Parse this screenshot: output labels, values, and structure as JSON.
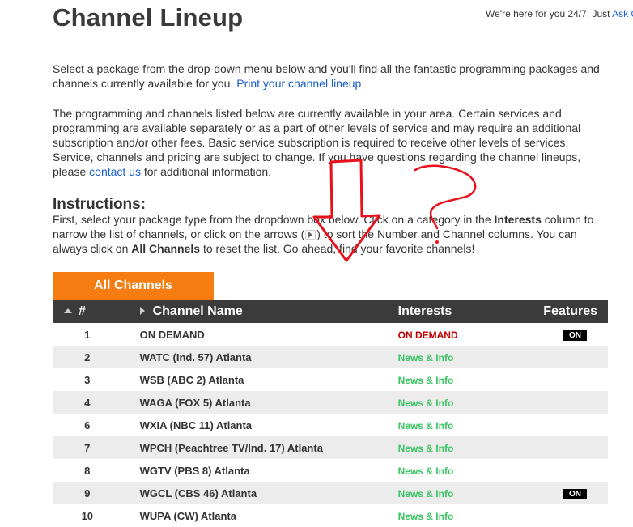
{
  "header": {
    "title": "Channel Lineup",
    "support_text": "We're here for you 24/7. Just",
    "support_link": "Ask Q"
  },
  "intro": {
    "text": "Select a package from the drop-down menu below and you'll find all the fantastic programming packages and channels currently available for you.",
    "print_link": "Print your channel lineup."
  },
  "disclaimer": {
    "text_before": "The programming and channels listed below are currently available in your area. Certain services and programming are available separately or as a part of other levels of service and may require an additional subscription and/or other fees. Basic service subscription is required to receive other levels of services. Service, channels and pricing are subject to change. If you have questions regarding the channel lineups, please",
    "contact_link": "contact us",
    "text_after": "for additional information."
  },
  "instructions": {
    "heading": "Instructions:",
    "part1": "First, select your package type from the dropdown box below. Click on a category in the",
    "interests_word": "Interests",
    "part2": "column to narrow the list of channels, or click on the arrows (",
    "part3": ") to sort the Number and Channel columns. You can always click on",
    "all_channels_word": "All Channels",
    "part4": "to reset the list. Go ahead, find your favorite channels!"
  },
  "tabs": {
    "all_channels": "All Channels"
  },
  "table": {
    "headers": {
      "number": "#",
      "name": "Channel Name",
      "interests": "Interests",
      "features": "Features"
    },
    "rows": [
      {
        "number": "1",
        "name": "ON DEMAND",
        "interest": "ON DEMAND",
        "interest_type": "ondemand",
        "feature": "ON"
      },
      {
        "number": "2",
        "name": "WATC (Ind. 57) Atlanta",
        "interest": "News & Info",
        "interest_type": "news",
        "feature": ""
      },
      {
        "number": "3",
        "name": "WSB (ABC 2) Atlanta",
        "interest": "News & Info",
        "interest_type": "news",
        "feature": ""
      },
      {
        "number": "4",
        "name": "WAGA (FOX 5) Atlanta",
        "interest": "News & Info",
        "interest_type": "news",
        "feature": ""
      },
      {
        "number": "6",
        "name": "WXIA (NBC 11) Atlanta",
        "interest": "News & Info",
        "interest_type": "news",
        "feature": ""
      },
      {
        "number": "7",
        "name": "WPCH (Peachtree TV/Ind. 17) Atlanta",
        "interest": "News & Info",
        "interest_type": "news",
        "feature": ""
      },
      {
        "number": "8",
        "name": "WGTV (PBS 8) Atlanta",
        "interest": "News & Info",
        "interest_type": "news",
        "feature": ""
      },
      {
        "number": "9",
        "name": "WGCL (CBS 46) Atlanta",
        "interest": "News & Info",
        "interest_type": "news",
        "feature": "ON"
      },
      {
        "number": "10",
        "name": "WUPA (CW) Atlanta",
        "interest": "News & Info",
        "interest_type": "news",
        "feature": ""
      }
    ]
  },
  "colors": {
    "accent_orange": "#f57d11",
    "header_dark": "#3b3b3b",
    "news_green": "#3bc463",
    "ondemand_red": "#c00000",
    "link_blue": "#1a5ecf",
    "annotation_red": "#e8101a"
  }
}
